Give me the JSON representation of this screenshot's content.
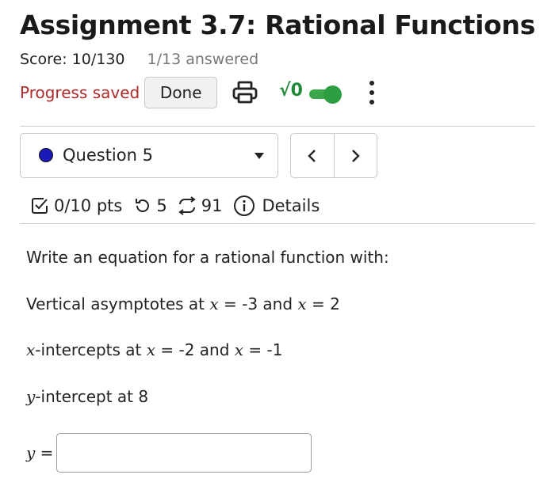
{
  "header": {
    "title": "Assignment 3.7: Rational Functions",
    "score": "Score: 10/130",
    "answered": "1/13 answered",
    "progress_saved": "Progress saved",
    "done_label": "Done",
    "sqrt_label": "√0",
    "print_icon": "printer-icon",
    "toggle_state": "on",
    "accent_color": "#2e9e42",
    "saved_color": "#b02a2a"
  },
  "question_nav": {
    "selected": "Question 5",
    "status_color": "#1a1ab8",
    "prev_label": "<",
    "next_label": ">"
  },
  "meta": {
    "points": "0/10 pts",
    "attempts": "5",
    "submissions": "91",
    "details_label": "Details"
  },
  "question": {
    "intro": "Write an equation for a rational function with:",
    "va_prefix": "Vertical asymptotes at ",
    "va_x1": "x",
    "va_mid1": " = -3 and ",
    "va_x2": "x",
    "va_end": " = 2",
    "xi_var": "x",
    "xi_prefix": "-intercepts at ",
    "xi_x1": "x",
    "xi_mid": " = -2 and ",
    "xi_x2": "x",
    "xi_end": " = -1",
    "yi_var": "y",
    "yi_text": "-intercept at 8"
  },
  "answer": {
    "var": "y",
    "eq": " =",
    "value": "",
    "placeholder": ""
  }
}
